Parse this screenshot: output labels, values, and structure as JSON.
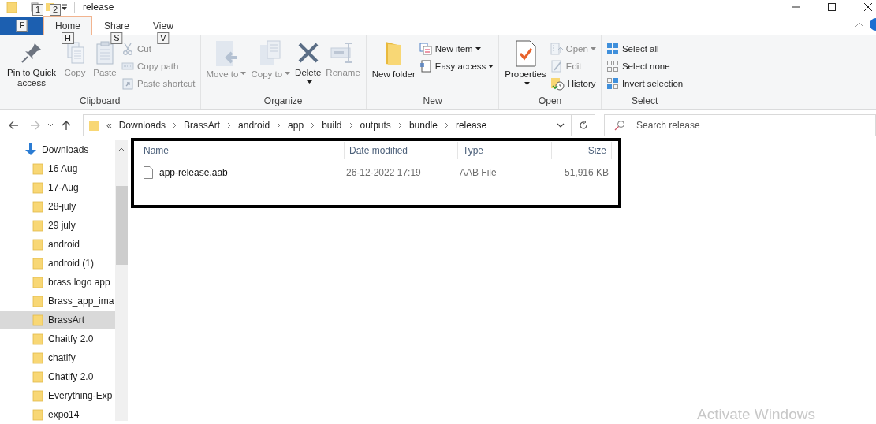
{
  "title_bar": {
    "title": "release",
    "quick_access_key_tips": [
      "1",
      "2"
    ]
  },
  "file_tab": {
    "key_tip": "F"
  },
  "ribbon_tabs": [
    {
      "label": "Home",
      "key_tip": "H",
      "selected": true
    },
    {
      "label": "Share",
      "key_tip": "S",
      "selected": false
    },
    {
      "label": "View",
      "key_tip": "V",
      "selected": false
    }
  ],
  "ribbon_groups": [
    {
      "label": "Clipboard",
      "items": [
        {
          "kind": "large",
          "label": "Pin to Quick access",
          "disabled": false,
          "has_menu": false
        },
        {
          "kind": "large",
          "label": "Copy",
          "disabled": true,
          "has_menu": false
        },
        {
          "kind": "large",
          "label": "Paste",
          "disabled": true,
          "has_menu": false
        },
        {
          "kind": "small",
          "label": "Cut",
          "disabled": true,
          "has_menu": false
        },
        {
          "kind": "small",
          "label": "Copy path",
          "disabled": true,
          "has_menu": false
        },
        {
          "kind": "small",
          "label": "Paste shortcut",
          "disabled": true,
          "has_menu": false
        }
      ]
    },
    {
      "label": "Organize",
      "items": [
        {
          "kind": "large",
          "label": "Move to",
          "disabled": true,
          "has_menu": true
        },
        {
          "kind": "large",
          "label": "Copy to",
          "disabled": true,
          "has_menu": true
        },
        {
          "kind": "large",
          "label": "Delete",
          "disabled": false,
          "has_menu": true
        },
        {
          "kind": "large",
          "label": "Rename",
          "disabled": true,
          "has_menu": false
        }
      ]
    },
    {
      "label": "New",
      "items": [
        {
          "kind": "large",
          "label": "New folder",
          "disabled": false,
          "has_menu": false
        },
        {
          "kind": "small",
          "label": "New item",
          "disabled": false,
          "has_menu": true
        },
        {
          "kind": "small",
          "label": "Easy access",
          "disabled": false,
          "has_menu": true
        }
      ]
    },
    {
      "label": "Open",
      "items": [
        {
          "kind": "large",
          "label": "Properties",
          "disabled": false,
          "has_menu": true
        },
        {
          "kind": "small",
          "label": "Open",
          "disabled": true,
          "has_menu": true
        },
        {
          "kind": "small",
          "label": "Edit",
          "disabled": true,
          "has_menu": false
        },
        {
          "kind": "small",
          "label": "History",
          "disabled": false,
          "has_menu": false
        }
      ]
    },
    {
      "label": "Select",
      "items": [
        {
          "kind": "small",
          "label": "Select all",
          "disabled": false,
          "has_menu": false
        },
        {
          "kind": "small",
          "label": "Select none",
          "disabled": false,
          "has_menu": false
        },
        {
          "kind": "small",
          "label": "Invert selection",
          "disabled": false,
          "has_menu": false
        }
      ]
    }
  ],
  "address_bar": {
    "overflow": "«",
    "path": [
      "Downloads",
      "BrassArt",
      "android",
      "app",
      "build",
      "outputs",
      "bundle",
      "release"
    ]
  },
  "search": {
    "placeholder": "Search release"
  },
  "nav_tree": [
    {
      "label": "Downloads",
      "children": [
        {
          "label": "16 Aug",
          "selected": false
        },
        {
          "label": "17-Aug",
          "selected": false
        },
        {
          "label": "28-july",
          "selected": false
        },
        {
          "label": "29 july",
          "selected": false
        },
        {
          "label": "android",
          "selected": false
        },
        {
          "label": "android (1)",
          "selected": false
        },
        {
          "label": "brass logo app",
          "selected": false
        },
        {
          "label": "Brass_app_ima",
          "selected": false
        },
        {
          "label": "BrassArt",
          "selected": true
        },
        {
          "label": "Chaitfy 2.0",
          "selected": false
        },
        {
          "label": "chatify",
          "selected": false
        },
        {
          "label": "Chatify 2.0",
          "selected": false
        },
        {
          "label": "Everything-Exp",
          "selected": false
        },
        {
          "label": "expo14",
          "selected": false
        }
      ]
    }
  ],
  "file_list": {
    "columns": [
      "Name",
      "Date modified",
      "Type",
      "Size"
    ],
    "rows": [
      {
        "name": "app-release.aab",
        "date_modified": "26-12-2022 17:19",
        "type": "AAB File",
        "size": "51,916 KB"
      }
    ]
  },
  "system_notice": "Activate Windows"
}
